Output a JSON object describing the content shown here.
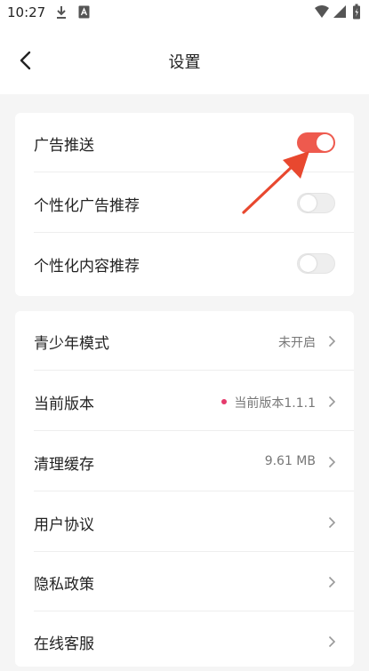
{
  "status_bar": {
    "time": "10:27"
  },
  "header": {
    "title": "设置"
  },
  "privacy_group": [
    {
      "label": "广告推送",
      "enabled": true
    },
    {
      "label": "个性化广告推荐",
      "enabled": false
    },
    {
      "label": "个性化内容推荐",
      "enabled": false
    }
  ],
  "settings_list": [
    {
      "label": "青少年模式",
      "value": "未开启"
    },
    {
      "label": "当前版本",
      "value": "当前版本1.1.1"
    },
    {
      "label": "清理缓存",
      "value": "9.61 MB"
    },
    {
      "label": "用户协议",
      "value": ""
    },
    {
      "label": "隐私政策",
      "value": ""
    },
    {
      "label": "在线客服",
      "value": ""
    }
  ],
  "colors": {
    "accent": "#ee5a4e",
    "update_dot": "#e53a6c",
    "annotation_arrow": "#e8482f"
  }
}
